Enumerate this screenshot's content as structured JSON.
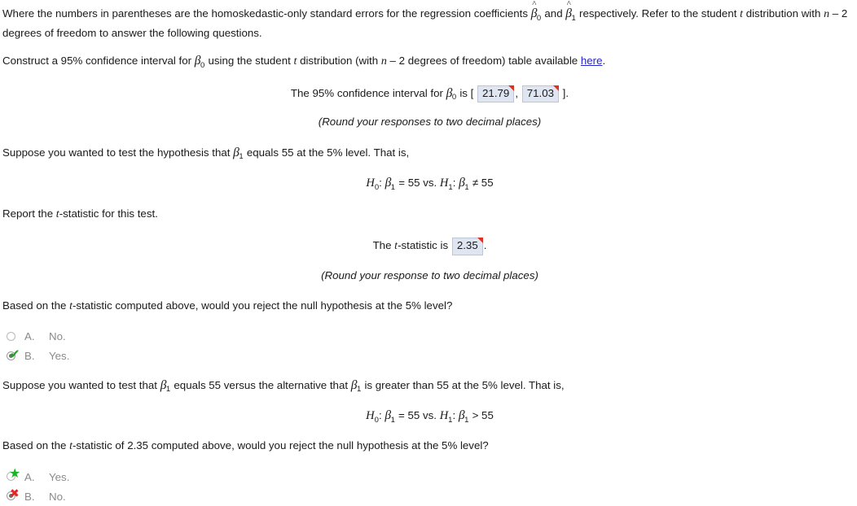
{
  "intro": {
    "line1_a": "Where the numbers in parentheses are the homoskedastic-only standard errors for the regression coefficients ",
    "beta0_hat": "β",
    "and": " and ",
    "beta1_hat": "β",
    "line1_b": " respectively. Refer to the student ",
    "t": "t",
    "line1_c": " distribution with ",
    "n": "n",
    "line1_d": " – 2",
    "line2": "degrees of freedom to answer the following questions."
  },
  "q1": {
    "prompt_a": "Construct a 95% confidence interval for ",
    "beta": "β",
    "beta_sub": "0",
    "prompt_b": " using the student ",
    "t": "t",
    "prompt_c": " distribution (with ",
    "n": "n",
    "prompt_d": " – 2 degrees of freedom) table available ",
    "link_label": "here",
    "period": ".",
    "answer_line_a": "The 95% confidence interval for ",
    "answer_line_b": " is [ ",
    "lower_value": "21.79",
    "separator": ", ",
    "upper_value": "71.03",
    "answer_line_c": " ].",
    "round_note": "(Round your responses to two decimal places)"
  },
  "q2": {
    "prompt_a": "Suppose you wanted to test the hypothesis that ",
    "beta": "β",
    "beta_sub": "1",
    "prompt_b": " equals 55 at the 5% level. That is,",
    "hyp_h0": "H",
    "hyp_h0_sub": "0",
    "hyp_h0_rest": ": ",
    "hyp_beta": "β",
    "hyp_beta_sub": "1",
    "hyp_eq": " = 55 vs. ",
    "hyp_h1": "H",
    "hyp_h1_sub": "1",
    "hyp_h1_rest": ": ",
    "hyp_alt_op": " ≠ 55",
    "report_line_a": "Report the ",
    "report_t": "t",
    "report_line_b": "-statistic for this test.",
    "tstat_line_a": "The ",
    "tstat_t": "t",
    "tstat_line_b": "-statistic is ",
    "tstat_value": "2.35",
    "tstat_line_c": ".",
    "round_note": "(Round your response to two decimal places)"
  },
  "q3": {
    "prompt_a": "Based on the ",
    "prompt_t": "t",
    "prompt_b": "-statistic computed above, would you reject the null hypothesis at the 5% level?",
    "options": [
      {
        "letter": "A.",
        "text": "No.",
        "state": "unselected",
        "marker": "none"
      },
      {
        "letter": "B.",
        "text": "Yes.",
        "state": "selected",
        "marker": "check"
      }
    ]
  },
  "q4": {
    "prompt_a": "Suppose you wanted to test that ",
    "beta": "β",
    "beta_sub": "1",
    "prompt_b": " equals 55 versus the alternative that ",
    "beta2": "β",
    "beta2_sub": "1",
    "prompt_c": " is greater than 55 at the 5% level. That is,",
    "hyp_h0": "H",
    "hyp_h0_sub": "0",
    "hyp_h0_rest": ": ",
    "hyp_beta": "β",
    "hyp_beta_sub": "1",
    "hyp_eq": " = 55 vs. ",
    "hyp_h1": "H",
    "hyp_h1_sub": "1",
    "hyp_h1_rest": ": ",
    "hyp_alt_op": " > 55",
    "question_a": "Based on the ",
    "question_t": "t",
    "question_b": "-statistic of 2.35 computed above, would you reject the null hypothesis at the 5% level?",
    "options": [
      {
        "letter": "A.",
        "text": "Yes.",
        "state": "unselected",
        "marker": "star"
      },
      {
        "letter": "B.",
        "text": "No.",
        "state": "selected",
        "marker": "cross"
      }
    ]
  },
  "colors": {
    "answer_box_fill": "#dfe5f1",
    "flag_red": "#e03020",
    "link_blue": "#2424cc",
    "correct_green": "#16a61e",
    "wrong_red": "#e8251f",
    "muted_gray": "#8a8a8a"
  }
}
